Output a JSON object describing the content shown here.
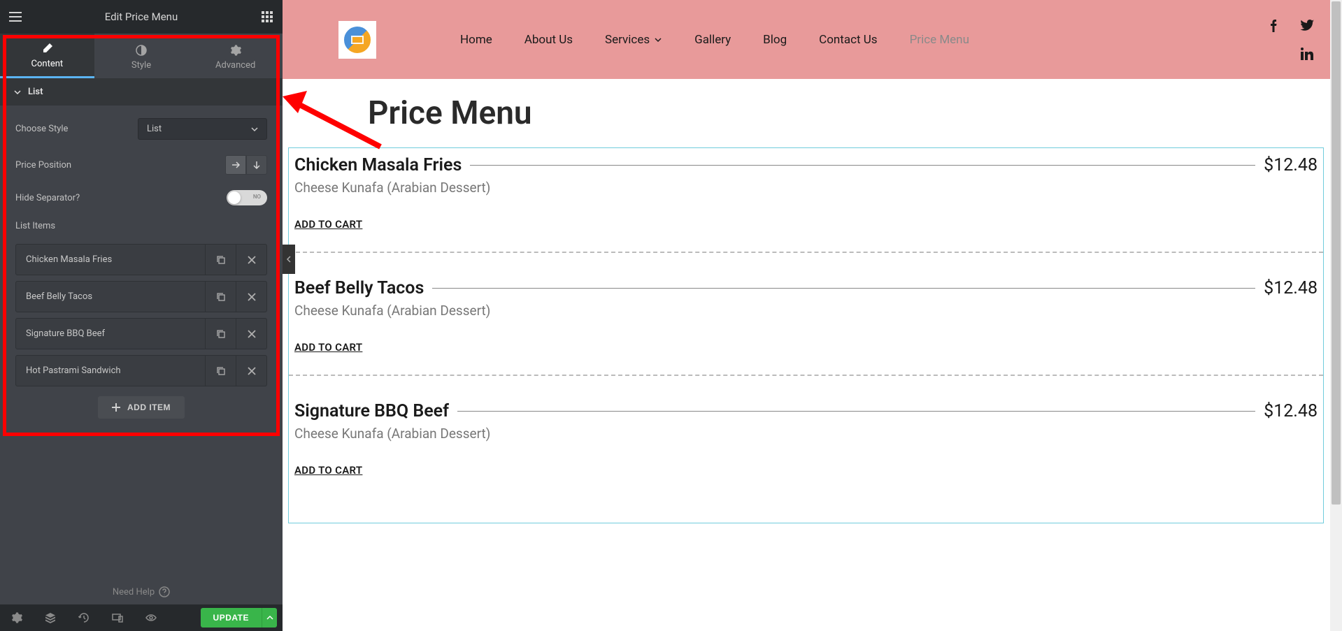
{
  "sidebar": {
    "title": "Edit Price Menu",
    "tabs": [
      {
        "label": "Content"
      },
      {
        "label": "Style"
      },
      {
        "label": "Advanced"
      }
    ],
    "accordion_title": "List",
    "choose_style_label": "Choose Style",
    "choose_style_value": "List",
    "price_position_label": "Price Position",
    "hide_separator_label": "Hide Separator?",
    "hide_separator_value": "NO",
    "list_items_label": "List Items",
    "items": [
      {
        "title": "Chicken Masala Fries"
      },
      {
        "title": "Beef Belly Tacos"
      },
      {
        "title": "Signature BBQ Beef"
      },
      {
        "title": "Hot Pastrami Sandwich"
      }
    ],
    "add_item_label": "ADD ITEM",
    "need_help": "Need Help",
    "update_label": "UPDATE"
  },
  "site": {
    "nav": [
      {
        "label": "Home"
      },
      {
        "label": "About Us"
      },
      {
        "label": "Services",
        "has_dropdown": true
      },
      {
        "label": "Gallery"
      },
      {
        "label": "Blog"
      },
      {
        "label": "Contact Us"
      },
      {
        "label": "Price Menu",
        "dimmed": true
      }
    ],
    "page_title": "Price Menu",
    "menu": [
      {
        "title": "Chicken Masala Fries",
        "desc": "Cheese Kunafa (Arabian Dessert)",
        "price": "$12.48",
        "cart": "ADD TO CART"
      },
      {
        "title": "Beef Belly Tacos",
        "desc": "Cheese Kunafa (Arabian Dessert)",
        "price": "$12.48",
        "cart": "ADD TO CART"
      },
      {
        "title": "Signature BBQ Beef",
        "desc": "Cheese Kunafa (Arabian Dessert)",
        "price": "$12.48",
        "cart": "ADD TO CART"
      }
    ]
  }
}
